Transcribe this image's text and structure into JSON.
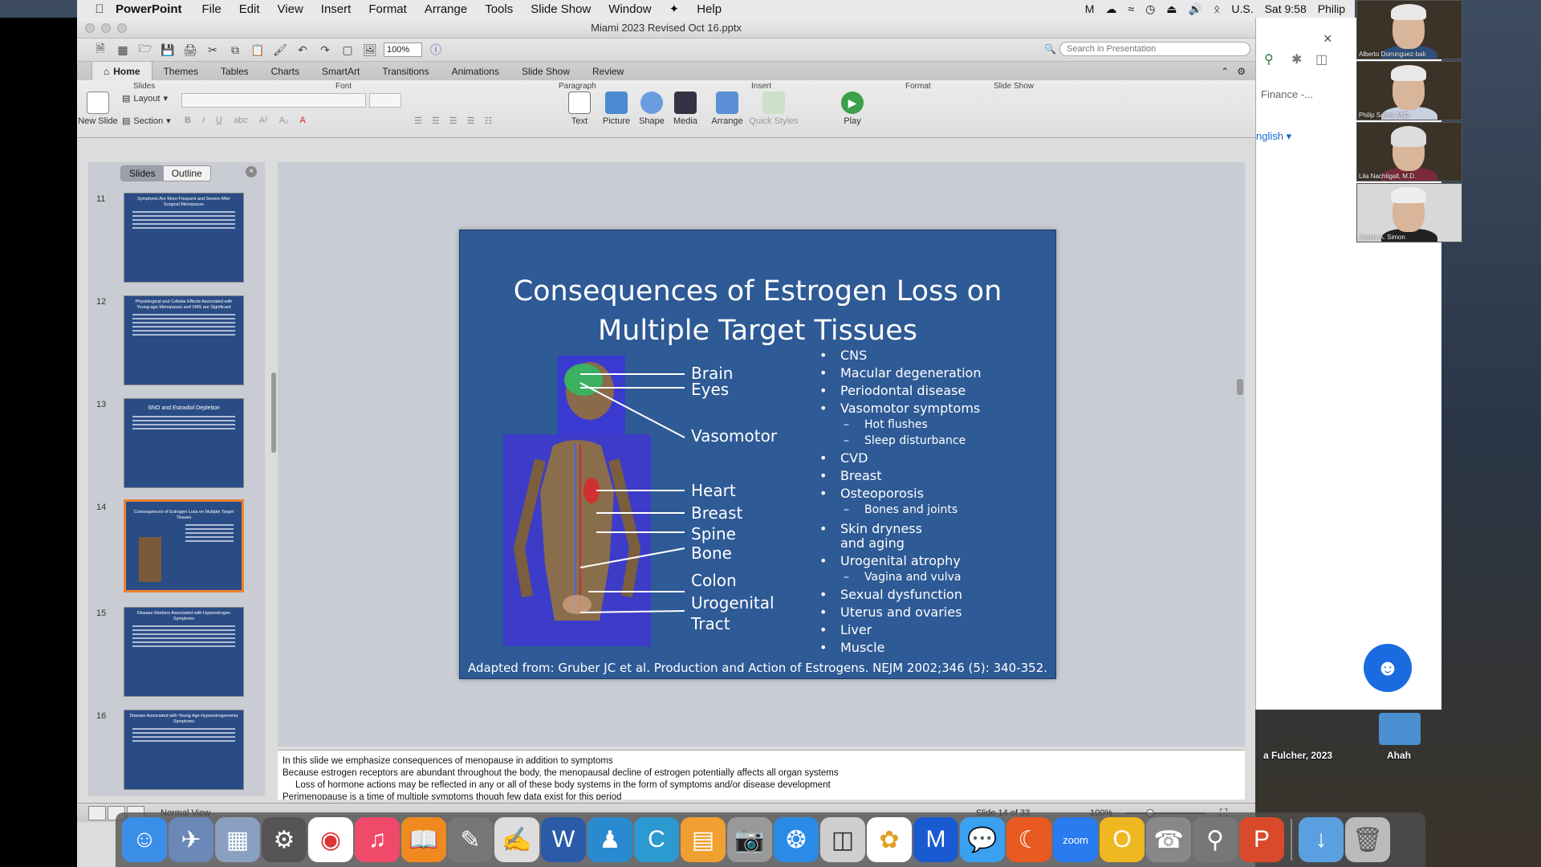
{
  "menubar": {
    "app_name": "PowerPoint",
    "items": [
      "File",
      "Edit",
      "View",
      "Insert",
      "Format",
      "Arrange",
      "Tools",
      "Slide Show",
      "Window",
      "Help"
    ],
    "input_source": "U.S.",
    "clock": "Sat 9:58",
    "user": "Philip"
  },
  "window": {
    "title": "Miami 2023 Revised Oct 16.pptx"
  },
  "toolbar": {
    "zoom": "100%",
    "search_placeholder": "Search in Presentation"
  },
  "ribbon": {
    "tabs": [
      "Home",
      "Themes",
      "Tables",
      "Charts",
      "SmartArt",
      "Transitions",
      "Animations",
      "Slide Show",
      "Review"
    ],
    "active_tab": "Home",
    "groups": {
      "slides": "Slides",
      "font": "Font",
      "paragraph": "Paragraph",
      "insert": "Insert",
      "format": "Format",
      "slide_show": "Slide Show"
    },
    "buttons": {
      "new_slide": "New Slide",
      "layout": "Layout",
      "section": "Section",
      "text": "Text",
      "picture": "Picture",
      "shape": "Shape",
      "media": "Media",
      "arrange": "Arrange",
      "quick_styles": "Quick Styles",
      "play": "Play"
    }
  },
  "slides_panel": {
    "tab_slides": "Slides",
    "tab_outline": "Outline",
    "thumbnails": [
      {
        "num": "11",
        "title": "Symptoms Are More Frequent and Severe After Surgical Menopause"
      },
      {
        "num": "12",
        "title": "Physiological and Cellular Effects Associated with Young-age Menopause and VMS are Significant"
      },
      {
        "num": "13",
        "title": "SNO and Estradiol Depletion"
      },
      {
        "num": "14",
        "title": "Consequences of Estrogen Loss on Multiple Target Tissues"
      },
      {
        "num": "15",
        "title": "Disease Markers Associated with Hypoestrogen Symptoms"
      },
      {
        "num": "16",
        "title": "Disease Associated with Young Age Hypoestrogenemia Symptoms"
      }
    ]
  },
  "slide": {
    "title_line1": "Consequences of Estrogen Loss on",
    "title_line2": "Multiple Target Tissues",
    "figure_labels": [
      "Brain",
      "Eyes",
      "Vasomotor",
      "Heart",
      "Breast",
      "Spine",
      "Bone",
      "Colon",
      "Urogenital",
      "Tract"
    ],
    "bullets": [
      {
        "text": "CNS"
      },
      {
        "text": "Macular degeneration"
      },
      {
        "text": "Periodontal disease"
      },
      {
        "text": "Vasomotor symptoms"
      },
      {
        "sub": "Hot flushes"
      },
      {
        "sub": "Sleep disturbance"
      },
      {
        "text": "CVD"
      },
      {
        "text": "Breast"
      },
      {
        "text": "Osteoporosis"
      },
      {
        "sub": "Bones and joints"
      },
      {
        "text": "Skin dryness"
      },
      {
        "cont": "and aging"
      },
      {
        "text": "Urogenital atrophy"
      },
      {
        "sub": "Vagina and vulva"
      },
      {
        "text": "Sexual dysfunction"
      },
      {
        "text": "Uterus and ovaries"
      },
      {
        "text": "Liver"
      },
      {
        "text": "Muscle"
      }
    ],
    "citation": "Adapted from: Gruber JC et al. Production and Action of Estrogens. NEJM 2002;346 (5): 340-352."
  },
  "notes": [
    "In this slide we emphasize consequences of menopause in addition to symptoms",
    "Because estrogen receptors are abundant throughout the body, the menopausal decline of estrogen potentially affects all organ systems",
    "     Loss of hormone actions may be reflected in any or all of these body systems in the form of symptoms and/or disease development",
    "Perimenopause is a time of multiple symptoms though few data exist for this period"
  ],
  "statusbar": {
    "view": "Normal View",
    "slide_count": "Slide 14 of 33",
    "zoom": "100%"
  },
  "browser": {
    "tab_label": "Finance -...",
    "language": "nglish"
  },
  "desktop_labels": [
    "a Fulcher, 2023",
    "Ahah"
  ],
  "video_participants": [
    "Alberto Dominguez-bali",
    "Philip Sarrel, M.D.",
    "Lila Nachtigall, M.D.",
    "James A. Simon"
  ],
  "colors": {
    "slide_bg": "#2e5a95",
    "selected_thumb": "#f08030",
    "assistant": "#1a6be0"
  }
}
